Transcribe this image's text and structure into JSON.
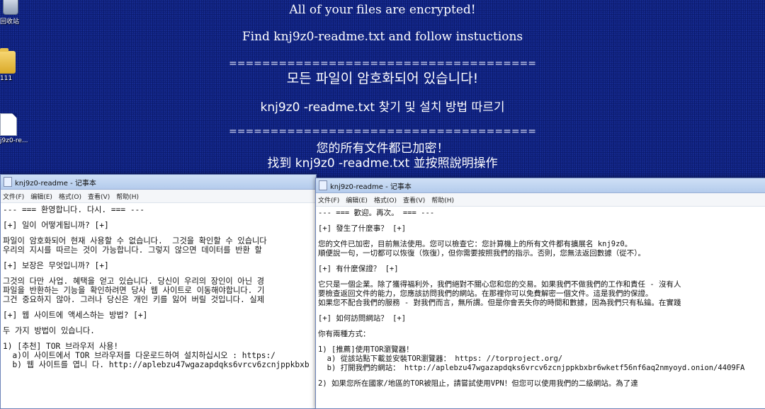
{
  "wallpaper": {
    "line1": "All of your files are encrypted!",
    "line2": "Find knj9z0-readme.txt and follow instuctions",
    "separator": "=====================================",
    "korean1": "모든 파일이 암호화되어 있습니다!",
    "korean2": "knj9z0 -readme.txt 찾기 및 설치 방법 따르기",
    "chinese1": "您的所有文件都已加密！",
    "chinese2": "找到 knj9z0 -readme.txt 並按照說明操作"
  },
  "desktop_icons": {
    "recycle_label": "回收站",
    "folder_label": "111",
    "readme_label": "j9z0-re..."
  },
  "notepad_korean": {
    "title": "knj9z0-readme - 记事本",
    "menu": [
      "文件(F)",
      "编辑(E)",
      "格式(O)",
      "查看(V)",
      "帮助(H)"
    ],
    "lines": [
      "--- === 환영합니다. 다시. === ---",
      "",
      "[+] 일이 어떻게됩니까? [+]",
      "",
      "파일이 암호화되어 현재 사용할 수 없습니다.  그것을 확인할 수 있습니다",
      "우리의 지시를 따르는 것이 가능합니다. 그렇지 않으면 데이터를 반환 할",
      "",
      "[+] 보장은 무엇입니까? [+]",
      "",
      "그것의 다만 사업. 혜택을 얻고 있습니다. 당신이 우리의 장인이 아닌 경",
      "파일을 반환하는 기능을 확인하려면 당사 웹 사이트로 이동해야합니다. 기",
      "그건 중요하지 않아. 그러나 당신은 개인 키를 잃어 버릴 것입니다. 실제",
      "",
      "[+] 웹 사이트에 액세스하는 방법? [+]",
      "",
      "두 가지 방법이 있습니다.",
      "",
      "1) [추천] TOR 브라우저 사용!",
      "  a)이 사이트에서 TOR 브라우저를 다운로드하여 설치하십시오 : https:/",
      "  b) 웹 사이트를 엽니 다. http://aplebzu47wgazapdqks6vrcv6zcnjppkbxb"
    ]
  },
  "notepad_chinese": {
    "title": "knj9z0-readme - 记事本",
    "menu": [
      "文件(F)",
      "编辑(E)",
      "格式(O)",
      "查看(V)",
      "帮助(H)"
    ],
    "lines": [
      "--- === 歡迎。再次。 === ---",
      "",
      "[+] 發生了什麼事？ [+]",
      "",
      "您的文件已加密，目前無法使用。您可以檢查它：您計算機上的所有文件都有擴展名 knj9z0。",
      "順便說一句，一切都可以恢復（恢復），但你需要按照我們的指示。否則，您無法返回數據（從不）。",
      "",
      "[+] 有什麼保證？ [+]",
      "",
      "它只是一個企業。除了獲得福利外，我們絕對不關心您和您的交易。如果我們不做我們的工作和責任 - 沒有人",
      "要檢查返回文件的能力，您應該訪問我們的網站。在那裡你可以免費解密一個文件。這是我們的保證。",
      "如果您不配合我們的服務 - 對我們而言，無所謂。但是你會丟失你的時間和數據，因為我們只有私鑰。在實踐",
      "",
      "[+] 如何訪問網站？ [+]",
      "",
      "你有兩種方式：",
      "",
      "1) [推薦]使用TOR瀏覽器！",
      "  a) 從該站點下載並安裝TOR瀏覽器： https: //torproject.org/",
      "  b) 打開我們的網站： http://aplebzu47wgazapdqks6vrcv6zcnjppkbxbr6wketf56nf6aq2nmyoyd.onion/4409FA",
      "",
      "2) 如果您所在國家/地區的TOR被阻止，請嘗試使用VPN！但您可以使用我們的二級網站。為了達"
    ]
  }
}
